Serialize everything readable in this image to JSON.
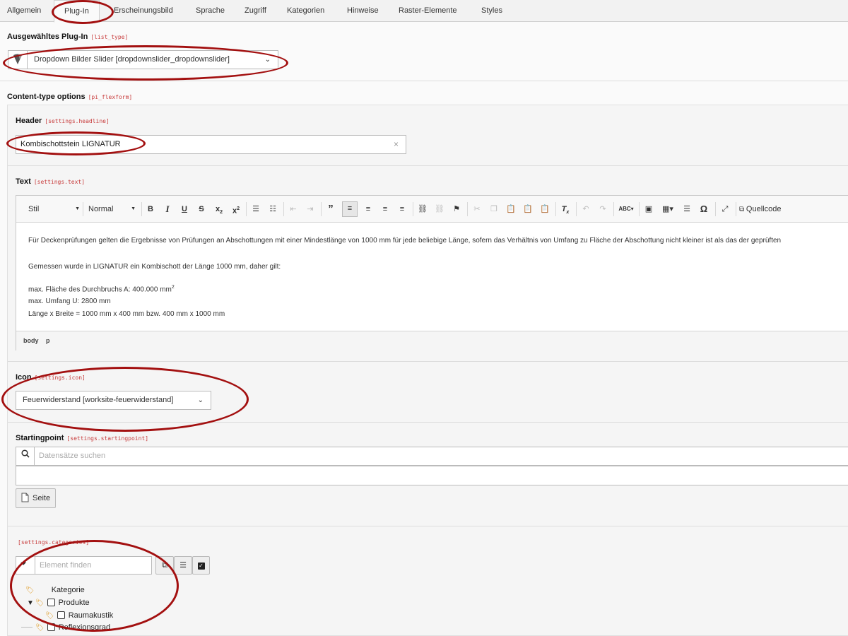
{
  "tabs": [
    "Allgemein",
    "Plug-In",
    "Erscheinungsbild",
    "Sprache",
    "Zugriff",
    "Kategorien",
    "Hinweise",
    "Raster-Elemente",
    "Styles"
  ],
  "plugin": {
    "label": "Ausgewähltes Plug-In",
    "code": "[list_type]",
    "selected": "Dropdown Bilder Slider [dropdownslider_dropdownslider]"
  },
  "content_type": {
    "label": "Content-type options",
    "code": "[pi_flexform]"
  },
  "header": {
    "label": "Header",
    "code": "[settings.headline]",
    "value": "Kombischottstein LIGNATUR"
  },
  "text": {
    "label": "Text",
    "code": "[settings.text]",
    "toolbar": {
      "style": "Stil",
      "format": "Normal",
      "source": "Quellcode"
    },
    "lines": [
      "Für Deckenprüfungen gelten die Ergebnisse von Prüfungen an Abschottungen mit einer Mindestlänge von 1000 mm für jede beliebige Länge, sofern das Verhältnis von Umfang zu Fläche der Abschottung nicht kleiner ist als das der geprüften",
      "Gemessen wurde in LIGNATUR ein Kombischott der Länge 1000 mm, daher gilt:",
      "max. Fläche des Durchbruchs A: 400.000 mm",
      "max. Umfang U: 2800 mm",
      "Länge x Breite = 1000 mm x 400 mm bzw. 400 mm x 1000 mm"
    ],
    "superscript": "2",
    "path": [
      "body",
      "p"
    ]
  },
  "icon": {
    "label": "Icon",
    "code": "[settings.icon]",
    "selected": "Feuerwiderstand [worksite-feuerwiderstand]"
  },
  "startingpoint": {
    "label": "Startingpoint",
    "code": "[settings.startingpoint]",
    "search_placeholder": "Datensätze suchen",
    "page_button": "Seite"
  },
  "categories": {
    "code": "[settings.categories]",
    "filter_placeholder": "Element finden",
    "tree": [
      {
        "label": "Kategorie",
        "depth": 0,
        "checkbox": false,
        "toggle": ""
      },
      {
        "label": "Produkte",
        "depth": 1,
        "checkbox": true,
        "toggle": "▼"
      },
      {
        "label": "Raumakustik",
        "depth": 2,
        "checkbox": true,
        "toggle": ""
      },
      {
        "label": "Reflexionsgrad",
        "depth": 1,
        "checkbox": true,
        "toggle": ""
      }
    ]
  },
  "colors": {
    "highlight": "#a31010",
    "code": "#c83c3c",
    "tag": "#e0a030"
  }
}
